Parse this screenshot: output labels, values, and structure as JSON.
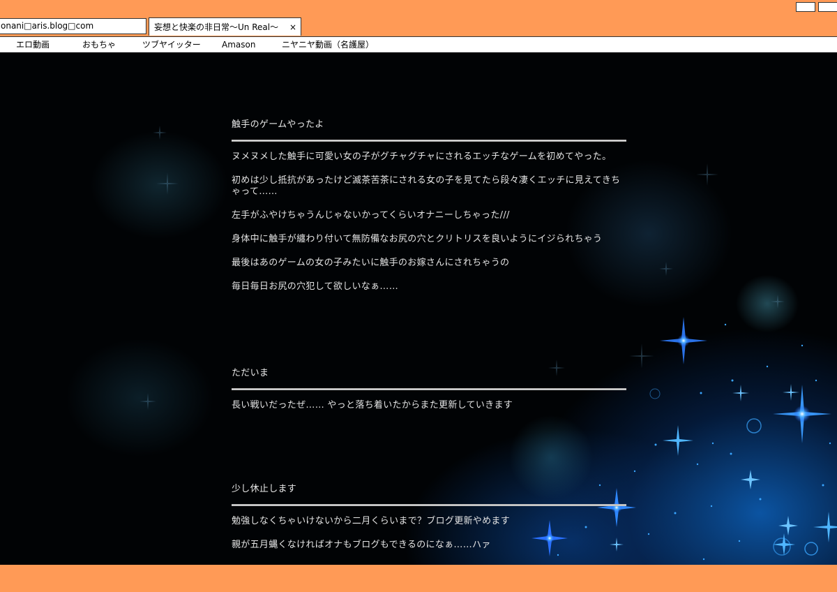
{
  "browser": {
    "url": "onani□aris.blog□com",
    "tab_title": "妄想と快楽の非日常～Un Real～",
    "tab_close": "×"
  },
  "bookmarks": [
    "エロ動画",
    "おもちゃ",
    "ツブヤイッター",
    "Amason",
    "ニヤニヤ動画（名護屋）"
  ],
  "posts": [
    {
      "title": "触手のゲームやったよ",
      "paragraphs": [
        " ヌメヌメした触手に可愛い女の子がグチャグチャにされるエッチなゲームを初めてやった。",
        "初めは少し抵抗があったけど滅茶苦茶にされる女の子を見てたら段々凄くエッチに見えてきちゃって……",
        "左手がふやけちゃうんじゃないかってくらいオナニーしちゃった///",
        "身体中に触手が纏わり付いて無防備なお尻の穴とクリトリスを良いようにイジられちゃう",
        "最後はあのゲームの女の子みたいに触手のお嫁さんにされちゃうの",
        "毎日毎日お尻の穴犯して欲しいなぁ……"
      ]
    },
    {
      "title": "ただいま",
      "paragraphs": [
        " 長い戦いだったぜ…… やっと落ち着いたからまた更新していきます"
      ]
    },
    {
      "title": "少し休止します",
      "paragraphs": [
        " 勉強しなくちゃいけないから二月くらいまで？ブログ更新やめます",
        "親が五月蝿くなければオナもブログもできるのになぁ……ハァ"
      ]
    }
  ],
  "theme": {
    "chrome": "#ff9a56",
    "page_bg": "#010305",
    "text": "#e4e4e4",
    "sparkle": "#3aa6ff"
  }
}
